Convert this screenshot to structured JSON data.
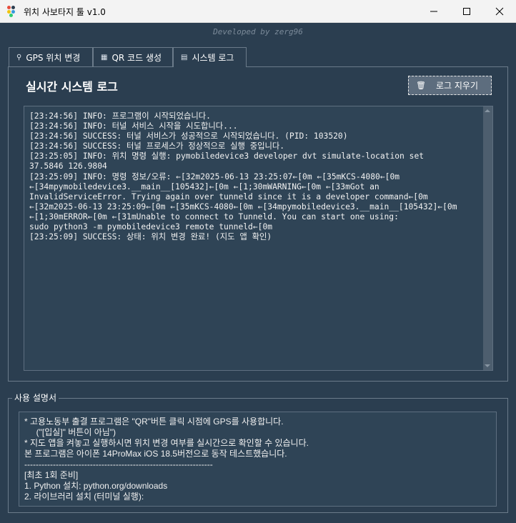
{
  "window": {
    "title": "위치 사보타지 툴 v1.0",
    "minimize_icon": "minimize-icon",
    "maximize_icon": "maximize-icon",
    "close_icon": "close-icon"
  },
  "developer": "Developed by zerg96",
  "tabs": [
    {
      "label": "GPS 위치 변경",
      "icon": "location-pin-icon",
      "active": false
    },
    {
      "label": "QR 코드 생성",
      "icon": "qr-icon",
      "active": false
    },
    {
      "label": "시스템 로그",
      "icon": "log-icon",
      "active": true
    }
  ],
  "log_panel": {
    "title": "실시간 시스템 로그",
    "clear_button": "로그 지우기",
    "clear_icon": "trash-icon",
    "lines": [
      "[23:24:56] INFO: 프로그램이 시작되었습니다.",
      "[23:24:56] INFO: 터널 서비스 시작을 시도합니다...",
      "[23:24:56] SUCCESS: 터널 서비스가 성공적으로 시작되었습니다. (PID: 103520)",
      "[23:24:56] SUCCESS: 터널 프로세스가 정상적으로 실행 중입니다.",
      "[23:25:05] INFO: 위치 명령 실행: pymobiledevice3 developer dvt simulate-location set",
      "37.5846 126.9804",
      "[23:25:09] INFO: 명령 정보/오류: ←[32m2025-06-13 23:25:07←[0m ←[35mKCS-4080←[0m",
      "←[34mpymobiledevice3.__main__[105432]←[0m ←[1;30mWARNING←[0m ←[33mGot an",
      "InvalidServiceError. Trying again over tunneld since it is a developer command←[0m",
      "←[32m2025-06-13 23:25:09←[0m ←[35mKCS-4080←[0m ←[34mpymobiledevice3.__main__[105432]←[0m",
      "←[1;30mERROR←[0m ←[31mUnable to connect to Tunneld. You can start one using:",
      "sudo python3 -m pymobiledevice3 remote tunneld←[0m",
      "[23:25:09] SUCCESS: 상태: 위치 변경 완료! (지도 앱 확인)"
    ]
  },
  "guide": {
    "legend": "사용 설명서",
    "lines": [
      "* 고용노동부 출결 프로그램은 \"QR\"버튼 클릭 시점에 GPS를 사용합니다.",
      "     (\"[입실]\" 버튼이 아님\")",
      "* 지도 앱을 켜놓고 실행하시면 위치 변경 여부를 실시간으로 확인할 수 있습니다.",
      "본 프로그램은 아이폰 14ProMax iOS 18.5버전으로 동작 테스트했습니다.",
      "------------------------------------------------------------------",
      "[최초 1회 준비]",
      "1. Python 설치: python.org/downloads",
      "2. 라이브러리 설치 (터미널 실행):"
    ]
  },
  "colors": {
    "background": "#2b3e50",
    "titlebar": "#f3f3f3",
    "button": "#5d6d7e",
    "textbox": "#2f4456"
  }
}
